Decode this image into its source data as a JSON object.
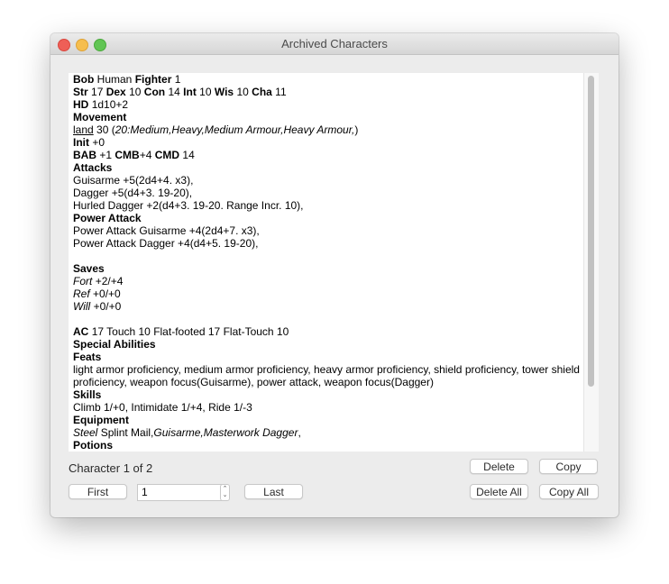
{
  "window": {
    "title": "Archived Characters"
  },
  "character": {
    "name": "Bob",
    "race": "Human",
    "class": "Fighter",
    "level": "1",
    "stats": [
      {
        "label": "Str",
        "value": "17"
      },
      {
        "label": "Dex",
        "value": "10"
      },
      {
        "label": "Con",
        "value": "14"
      },
      {
        "label": "Int",
        "value": "10"
      },
      {
        "label": "Wis",
        "value": "10"
      },
      {
        "label": "Cha",
        "value": "11"
      }
    ],
    "hd_label": "HD",
    "hd_value": "1d10+2",
    "movement_heading": "Movement",
    "movement_type": "land",
    "movement_speed": "30 (",
    "movement_details": "20:Medium,Heavy,Medium Armour,Heavy Armour,",
    "movement_close": ")",
    "init_label": "Init",
    "init_value": "+0",
    "bab_label": "BAB",
    "bab_value": "+1",
    "cmb_label": "CMB",
    "cmb_value": "+4",
    "cmd_label": "CMD",
    "cmd_value": "14",
    "attacks_heading": "Attacks",
    "attacks": [
      "Guisarme +5(2d4+4. x3),",
      "Dagger +5(d4+3. 19-20),",
      "Hurled Dagger +2(d4+3. 19-20. Range Incr. 10),"
    ],
    "power_attack_heading": "Power Attack",
    "power_attacks": [
      "Power Attack Guisarme +4(2d4+7. x3),",
      "Power Attack Dagger +4(d4+5. 19-20),"
    ],
    "saves_heading": "Saves",
    "saves": [
      {
        "label": "Fort",
        "value": "+2/+4"
      },
      {
        "label": "Ref",
        "value": "+0/+0"
      },
      {
        "label": "Will",
        "value": "+0/+0"
      }
    ],
    "ac_label": "AC",
    "ac_value": "17 Touch 10 Flat-footed 17 Flat-Touch 10",
    "special_abilities_heading": "Special Abilities",
    "feats_heading": "Feats",
    "feats": "light armor proficiency, medium armor proficiency, heavy armor proficiency, shield proficiency, tower shield proficiency, weapon focus(Guisarme), power attack, weapon focus(Dagger)",
    "skills_heading": "Skills",
    "skills": "Climb 1/+0, Intimidate 1/+4, Ride 1/-3",
    "equipment_heading": "Equipment",
    "equipment_material": "Steel",
    "equipment_armor": " Splint Mail,",
    "equipment_weapons": "Guisarme,Masterwork Dagger",
    "equipment_trail": ",",
    "potions_heading": "Potions"
  },
  "footer": {
    "status": "Character 1 of 2",
    "first_label": "First",
    "index_value": "1",
    "last_label": "Last",
    "delete_label": "Delete",
    "copy_label": "Copy",
    "delete_all_label": "Delete All",
    "copy_all_label": "Copy All"
  }
}
